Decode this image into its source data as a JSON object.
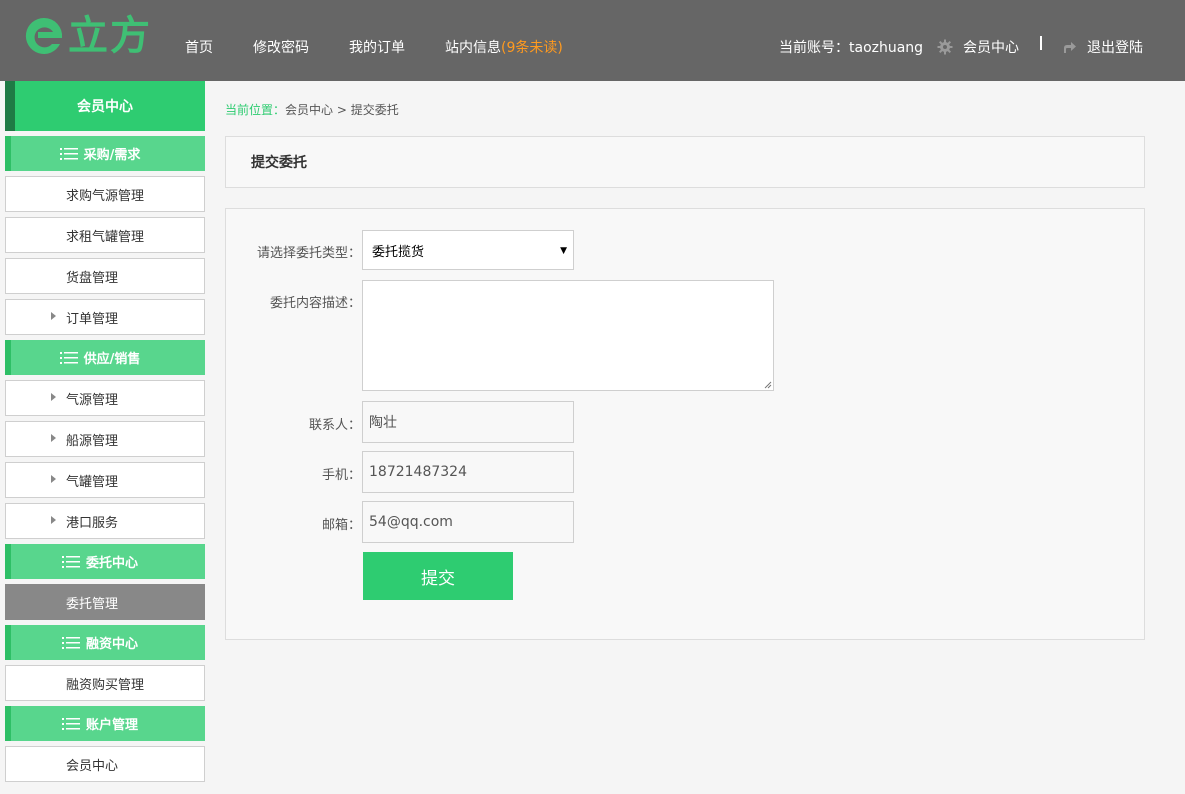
{
  "header": {
    "logo_text": "立方",
    "nav": [
      "首页",
      "修改密码",
      "我的订单",
      "站内信息"
    ],
    "unread": "(9条未读)",
    "account_label": "当前账号：",
    "account_name": "taozhuang",
    "member_center": "会员中心",
    "separator": "|",
    "logout": "退出登陆"
  },
  "sidebar": {
    "title": "会员中心",
    "sections": [
      {
        "label": "采购/需求",
        "items": [
          {
            "label": "求购气源管理"
          },
          {
            "label": "求租气罐管理"
          },
          {
            "label": "货盘管理"
          },
          {
            "label": "订单管理"
          }
        ]
      },
      {
        "label": "供应/销售",
        "items": [
          {
            "label": "气源管理"
          },
          {
            "label": "船源管理"
          },
          {
            "label": "气罐管理"
          },
          {
            "label": "港口服务"
          }
        ]
      },
      {
        "label": "委托中心",
        "items": [
          {
            "label": "委托管理"
          }
        ]
      },
      {
        "label": "融资中心",
        "items": [
          {
            "label": "融资购买管理"
          }
        ]
      },
      {
        "label": "账户管理",
        "items": [
          {
            "label": "会员中心"
          }
        ]
      }
    ]
  },
  "breadcrumb": {
    "current": "当前位置：",
    "path": "会员中心 > 提交委托"
  },
  "panel_title": "提交委托",
  "form": {
    "type_label": "请选择委托类型：",
    "type_value": "委托揽货",
    "desc_label": "委托内容描述：",
    "contact_label": "联系人：",
    "contact_value": "陶壮",
    "phone_label": "手机：",
    "phone_value": "18721487324",
    "email_label": "邮箱：",
    "email_value": "54@qq.com",
    "submit": "提交"
  },
  "colors": {
    "header_bg": "#666666",
    "accent": "#2ecc71",
    "unread": "#ff9a1f"
  }
}
